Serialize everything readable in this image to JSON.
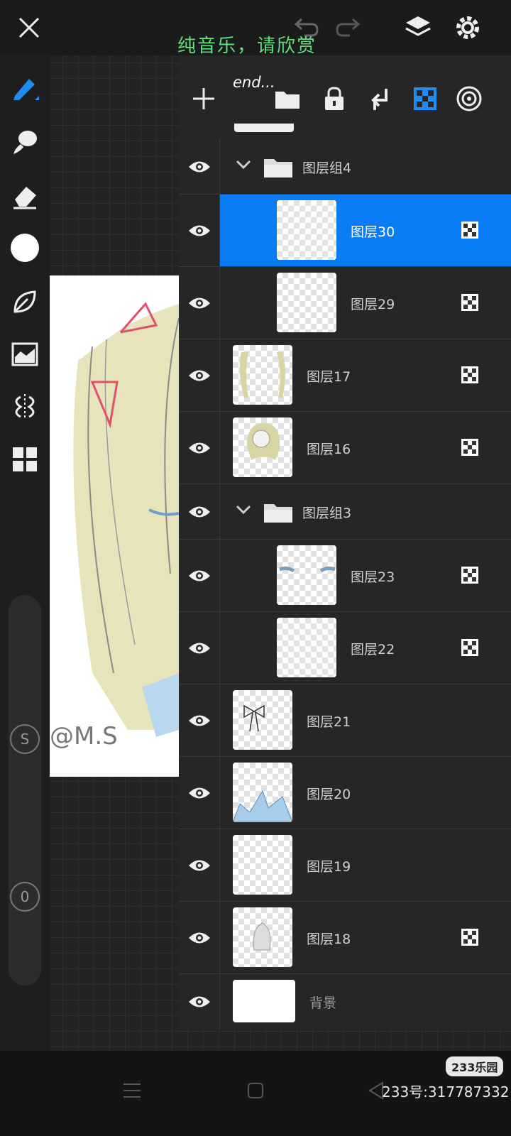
{
  "top_caption": "纯音乐，请欣赏",
  "panel_caption": "end...",
  "top_icons": [
    "close-icon",
    "undo-icon",
    "redo-icon",
    "layers-icon",
    "gear-icon"
  ],
  "left_tools": [
    "pen-icon",
    "smudge-icon",
    "eraser-icon",
    "color-swatch",
    "leaf-brush-icon",
    "filter-icon",
    "symmetry-icon",
    "grid-icon"
  ],
  "size_slider_label": "S",
  "opacity_slider_label": "0",
  "artwork_signature": "@M.S",
  "panel_tools": [
    "add-layer-icon",
    "folder-icon",
    "lock-icon",
    "merge-down-icon",
    "alpha-lock-icon",
    "blend-mode-icon"
  ],
  "layers": [
    {
      "type": "group",
      "name": "图层组4"
    },
    {
      "type": "layer",
      "name": "图层30",
      "indent": true,
      "selected": true,
      "alpha_lock": true
    },
    {
      "type": "layer",
      "name": "图层29",
      "indent": true,
      "alpha_lock": true
    },
    {
      "type": "layer",
      "name": "图层17",
      "indent": false,
      "alpha_lock": true
    },
    {
      "type": "layer",
      "name": "图层16",
      "indent": false,
      "alpha_lock": true
    },
    {
      "type": "group",
      "name": "图层组3"
    },
    {
      "type": "layer",
      "name": "图层23",
      "indent": true,
      "alpha_lock": true
    },
    {
      "type": "layer",
      "name": "图层22",
      "indent": true,
      "alpha_lock": true
    },
    {
      "type": "layer",
      "name": "图层21",
      "indent": false,
      "alpha_lock": false
    },
    {
      "type": "layer",
      "name": "图层20",
      "indent": false,
      "alpha_lock": false
    },
    {
      "type": "layer",
      "name": "图层19",
      "indent": false,
      "alpha_lock": false
    },
    {
      "type": "layer",
      "name": "图层18",
      "indent": false,
      "alpha_lock": true
    },
    {
      "type": "background",
      "name": "背景"
    }
  ],
  "watermark_badge": "233乐园",
  "watermark_id": "233号:317787332",
  "colors": {
    "accent": "#0a7cf5",
    "caption": "#5ee07c"
  }
}
